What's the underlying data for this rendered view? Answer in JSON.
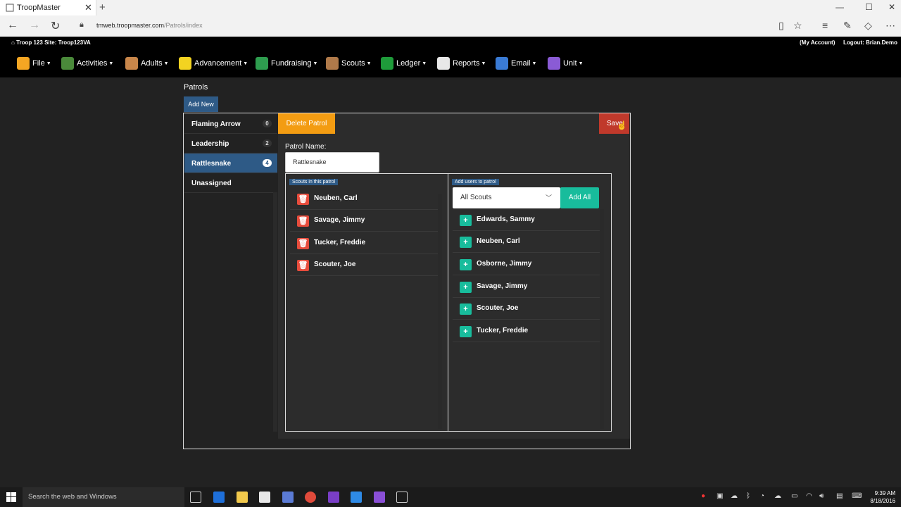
{
  "browser": {
    "tab_title": "TroopMaster",
    "new_tab_glyph": "+",
    "address_host": "tmweb.troopmaster.com",
    "address_path": "/Patrols/index"
  },
  "header": {
    "left_text": "Troop 123   Site: Troop123VA",
    "my_account": "(My Account)",
    "logout": "Logout: Brian.Demo"
  },
  "menu": [
    {
      "label": "File",
      "color": "#f5a623"
    },
    {
      "label": "Activities",
      "color": "#4a8a3a"
    },
    {
      "label": "Adults",
      "color": "#c8864a"
    },
    {
      "label": "Advancement",
      "color": "#f3d321"
    },
    {
      "label": "Fundraising",
      "color": "#2e9d4f"
    },
    {
      "label": "Scouts",
      "color": "#b07a4a"
    },
    {
      "label": "Ledger",
      "color": "#1e9b3a"
    },
    {
      "label": "Reports",
      "color": "#e8e8e8"
    },
    {
      "label": "Email",
      "color": "#3a7bd5"
    },
    {
      "label": "Unit",
      "color": "#8a5bd5"
    }
  ],
  "page": {
    "title": "Patrols",
    "add_new": "Add New"
  },
  "patrols": [
    {
      "name": "Flaming Arrow",
      "count": "0"
    },
    {
      "name": "Leadership",
      "count": "2"
    },
    {
      "name": "Rattlesnake",
      "count": "4"
    },
    {
      "name": "Unassigned",
      "count": ""
    }
  ],
  "editor": {
    "delete_label": "Delete Patrol",
    "save_label": "Save",
    "patrol_name_label": "Patrol Name:",
    "patrol_name_value": "Rattlesnake",
    "scouts_badge": "Scouts in this patrol",
    "add_users_badge": "Add users to patrol",
    "select_value": "All Scouts",
    "add_all": "Add All",
    "scouts_in_patrol": [
      "Neuben, Carl",
      "Savage, Jimmy",
      "Tucker, Freddie",
      "Scouter, Joe"
    ],
    "available_scouts": [
      "Edwards, Sammy",
      "Neuben, Carl",
      "Osborne, Jimmy",
      "Savage, Jimmy",
      "Scouter, Joe",
      "Tucker, Freddie"
    ]
  },
  "taskbar": {
    "search_placeholder": "Search the web and Windows",
    "time": "9:39 AM",
    "date": "8/18/2016"
  },
  "colors": {
    "accent_blue": "#2e5a86",
    "delete_orange": "#f39c12",
    "save_red": "#c0392b",
    "add_green": "#18bc9c",
    "remove_red": "#e74c3c"
  }
}
